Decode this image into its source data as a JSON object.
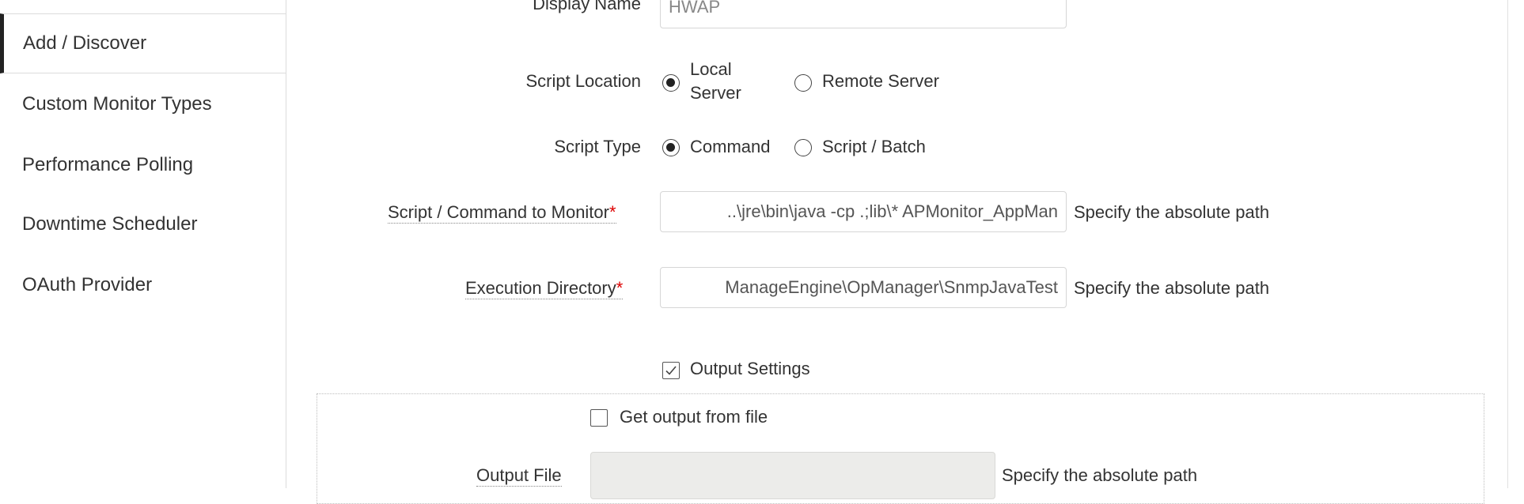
{
  "sidebar": {
    "items": [
      {
        "label": "Add / Discover",
        "active": true
      },
      {
        "label": "Custom Monitor Types",
        "active": false
      },
      {
        "label": "Performance Polling",
        "active": false
      },
      {
        "label": "Downtime Scheduler",
        "active": false
      },
      {
        "label": "OAuth Provider",
        "active": false
      }
    ]
  },
  "form": {
    "display_name": {
      "label": "Display Name",
      "value": "HWAP"
    },
    "script_location": {
      "label": "Script Location",
      "options": [
        {
          "label_line1": "Local",
          "label_line2": "Server",
          "checked": true
        },
        {
          "label": "Remote Server",
          "checked": false
        }
      ]
    },
    "script_type": {
      "label": "Script Type",
      "options": [
        {
          "label": "Command",
          "checked": true
        },
        {
          "label": "Script / Batch",
          "checked": false
        }
      ]
    },
    "script_command": {
      "label": "Script / Command to Monitor",
      "required_mark": "*",
      "value": "..\\jre\\bin\\java -cp .;lib\\* APMonitor_AppMan",
      "hint": "Specify the absolute path"
    },
    "execution_directory": {
      "label": "Execution Directory",
      "required_mark": "*",
      "value": "ManageEngine\\OpManager\\SnmpJavaTest",
      "hint": "Specify the absolute path"
    },
    "output_settings": {
      "label": "Output Settings",
      "checked": true
    },
    "get_output_from_file": {
      "label": "Get output from file",
      "checked": false
    },
    "output_file": {
      "label": "Output File",
      "value": "",
      "hint": "Specify the absolute path"
    }
  }
}
